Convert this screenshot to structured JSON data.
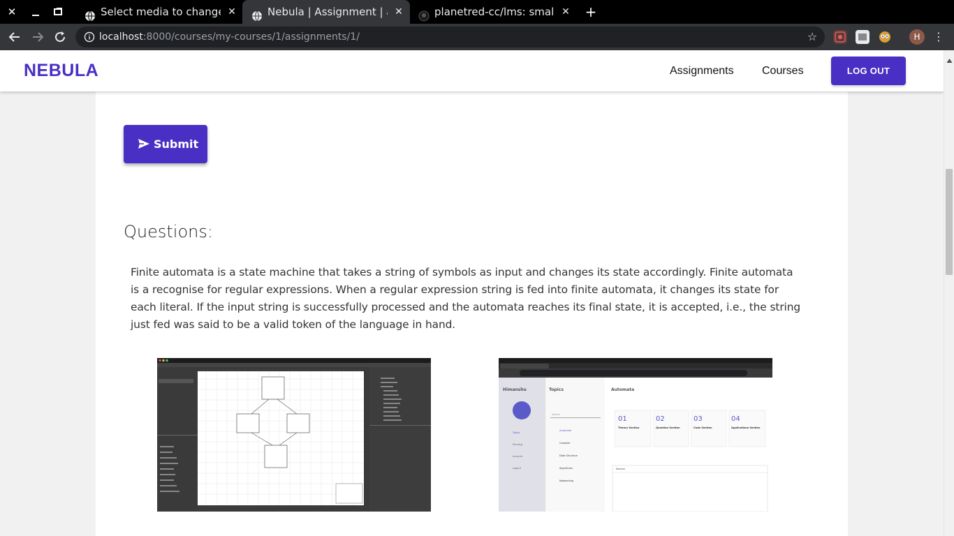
{
  "browser": {
    "tabs": [
      {
        "title": "Select media to change | D",
        "active": false
      },
      {
        "title": "Nebula | Assignment | ass",
        "active": true
      },
      {
        "title": "planetred-cc/lms: small im",
        "active": false
      }
    ],
    "url_host": "localhost",
    "url_path": ":8000/courses/my-courses/1/assignments/1/",
    "profile_initial": "H"
  },
  "app": {
    "brand": "NEBULA",
    "nav": {
      "assignments": "Assignments",
      "courses": "Courses",
      "logout": "LOG OUT"
    },
    "accent": "#4a2fc4"
  },
  "content": {
    "submit_label": "Submit",
    "questions_heading": "Questions:",
    "question_text": "Finite automata is a state machine that takes a string of symbols as input and changes its state accordingly. Finite automata is a recognise for regular expressions. When a regular expression string is fed into finite automata, it changes its state for each literal. If the input string is successfully processed and the automata reaches its final state, it is accepted, i.e., the string just fed was said to be a valid token of the language in hand."
  },
  "screenshot2": {
    "user": "Himanshu",
    "topics_title": "Topics",
    "main_title": "Automata",
    "search_placeholder": "Search",
    "sidebar": [
      "Topics",
      "Pending",
      "Account",
      "Logout"
    ],
    "topics": [
      "Automata",
      "Compiler",
      "Data Structure",
      "Algorithms",
      "Networking"
    ],
    "sections": [
      {
        "num": "01",
        "title": "Theory Section"
      },
      {
        "num": "02",
        "title": "Question Section"
      },
      {
        "num": "03",
        "title": "Code Section"
      },
      {
        "num": "04",
        "title": "Applications Section"
      }
    ],
    "editor_format": "Normal"
  }
}
